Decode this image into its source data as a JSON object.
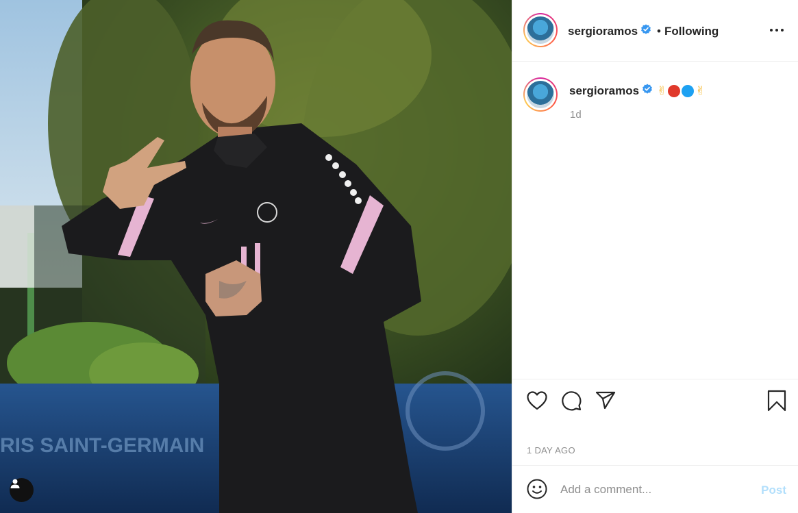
{
  "post": {
    "image_alt": "Player in black PSG training top making peace sign",
    "username": "sergioramos",
    "verified": true,
    "follow_sep": "•",
    "follow_status": "Following"
  },
  "caption": {
    "username": "sergioramos",
    "emojis": [
      "✌",
      "red-circle",
      "blue-circle",
      "✌"
    ],
    "time_short": "1d"
  },
  "actions": {
    "icons": [
      "heart-icon",
      "comment-icon",
      "share-icon",
      "bookmark-icon"
    ],
    "timestamp": "1 DAY AGO"
  },
  "comment_box": {
    "placeholder": "Add a comment...",
    "post_label": "Post"
  },
  "colors": {
    "verified_blue": "#3897f0",
    "post_disabled": "#b2dffc",
    "red_circle": "#e0392b",
    "blue_circle": "#1da1f2"
  }
}
